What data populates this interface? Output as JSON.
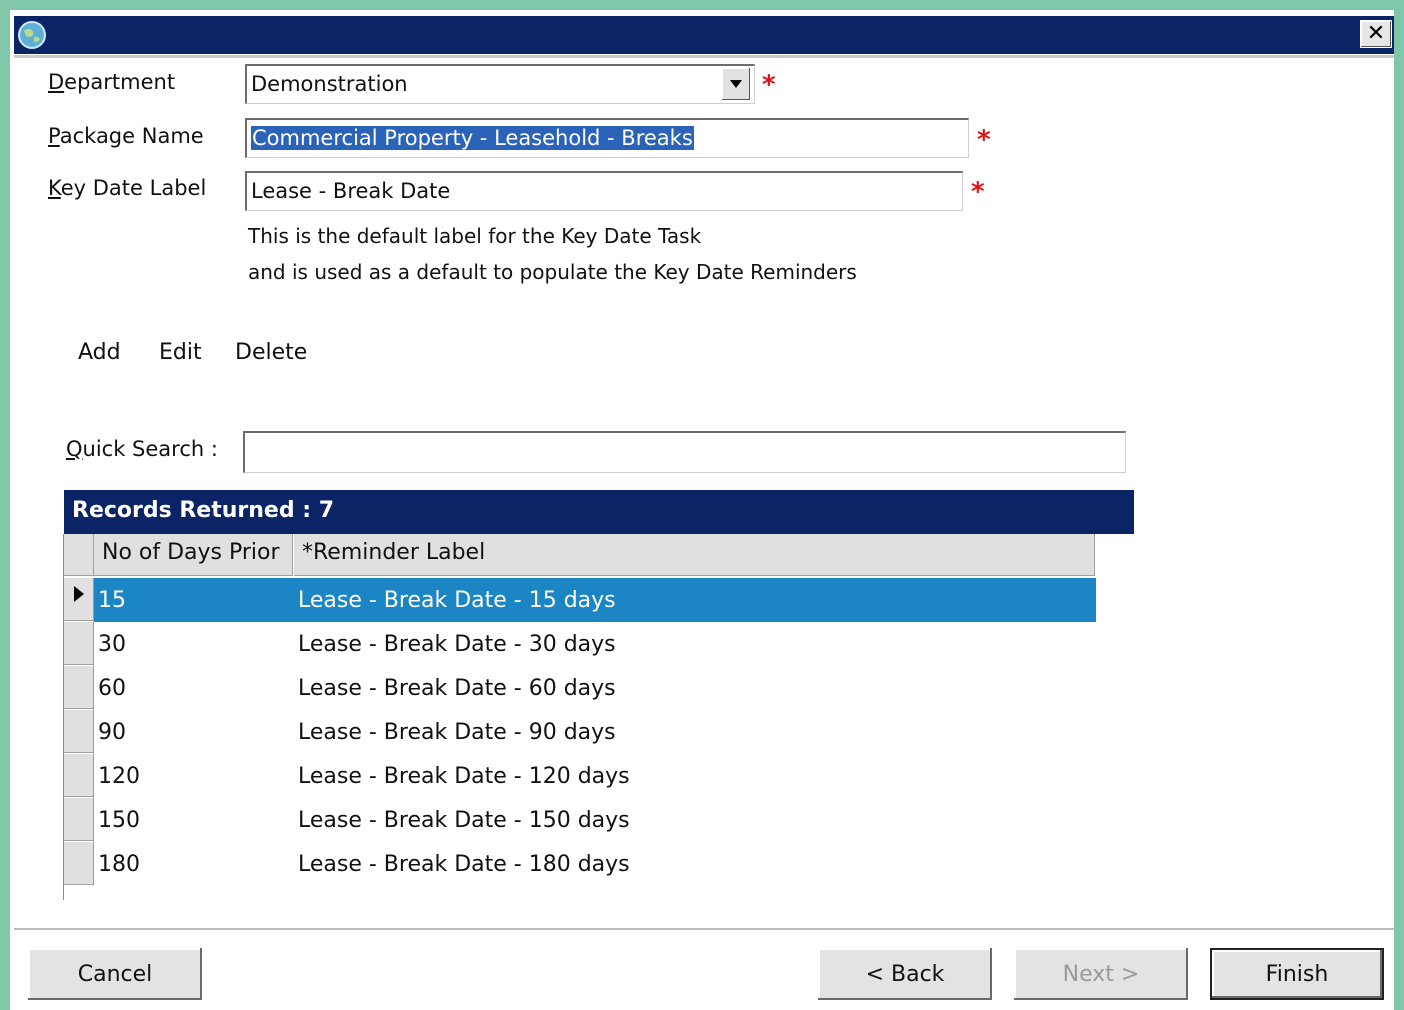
{
  "window": {
    "close_glyph": "✕"
  },
  "form": {
    "department": {
      "label_hot": "D",
      "label_rest": "epartment",
      "value": "Demonstration"
    },
    "package_name": {
      "label_hot": "P",
      "label_rest": "ackage Name",
      "value": "Commercial Property - Leasehold - Breaks"
    },
    "key_date_label": {
      "label_hot": "K",
      "label_rest": "ey Date Label",
      "value": "Lease - Break Date"
    },
    "required_marker": "*",
    "hint_line1": "This is the default label for the Key Date Task",
    "hint_line2": "and is used as a default to populate the Key Date Reminders"
  },
  "toolbar": {
    "add": "Add",
    "edit": "Edit",
    "delete": "Delete"
  },
  "search": {
    "label_hot": "Q",
    "label_rest": "uick Search :",
    "value": ""
  },
  "grid": {
    "records_returned": "Records Returned : 7",
    "columns": [
      "No of Days Prior",
      "*Reminder Label"
    ],
    "rows": [
      {
        "days": "15",
        "label": "Lease - Break Date - 15 days"
      },
      {
        "days": "30",
        "label": "Lease - Break Date - 30 days"
      },
      {
        "days": "60",
        "label": "Lease - Break Date - 60 days"
      },
      {
        "days": "90",
        "label": "Lease - Break Date - 90 days"
      },
      {
        "days": "120",
        "label": "Lease - Break Date - 120 days"
      },
      {
        "days": "150",
        "label": "Lease - Break Date - 150 days"
      },
      {
        "days": "180",
        "label": "Lease - Break Date - 180 days"
      }
    ]
  },
  "buttons": {
    "cancel": "Cancel",
    "back": "< Back",
    "next": "Next >",
    "finish": "Finish"
  },
  "colors": {
    "titlebar": "#0a2466",
    "selected_row": "#1b86c3",
    "required": "#e01414",
    "frame": "#7fc7a8"
  }
}
